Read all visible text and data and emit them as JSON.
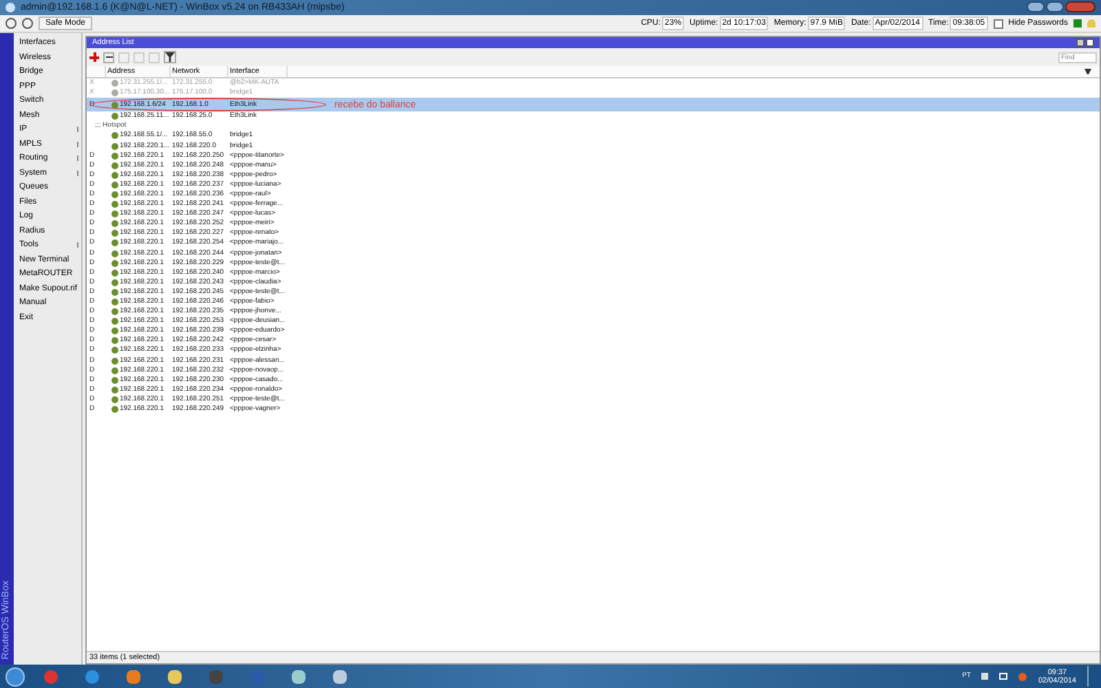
{
  "window": {
    "title": "admin@192.168.1.6 (K@N@L-NET) - WinBox v5.24 on RB433AH (mipsbe)"
  },
  "toolbar": {
    "safe_mode": "Safe Mode",
    "stats": [
      {
        "label": "CPU:",
        "value": "23%"
      },
      {
        "label": "Uptime:",
        "value": "2d 10:17:03"
      },
      {
        "label": "Memory:",
        "value": "97.9 MiB"
      },
      {
        "label": "Date:",
        "value": "Apr/02/2014"
      },
      {
        "label": "Time:",
        "value": "09:38:05"
      }
    ],
    "hide_passwords": {
      "label": "Hide Passwords",
      "checked": false
    }
  },
  "sidebar": {
    "brand": "RouterOS WinBox",
    "items": [
      {
        "label": "Interfaces",
        "submenu": false
      },
      {
        "label": "Wireless",
        "submenu": false
      },
      {
        "label": "Bridge",
        "submenu": false
      },
      {
        "label": "PPP",
        "submenu": false
      },
      {
        "label": "Switch",
        "submenu": false
      },
      {
        "label": "Mesh",
        "submenu": false
      },
      {
        "label": "IP",
        "submenu": true
      },
      {
        "label": "MPLS",
        "submenu": true
      },
      {
        "label": "Routing",
        "submenu": true
      },
      {
        "label": "System",
        "submenu": true
      },
      {
        "label": "Queues",
        "submenu": false
      },
      {
        "label": "Files",
        "submenu": false
      },
      {
        "label": "Log",
        "submenu": false
      },
      {
        "label": "Radius",
        "submenu": false
      },
      {
        "label": "Tools",
        "submenu": true
      },
      {
        "label": "New Terminal",
        "submenu": false
      },
      {
        "label": "MetaROUTER",
        "submenu": false
      },
      {
        "label": "Make Supout.rif",
        "submenu": false
      },
      {
        "label": "Manual",
        "submenu": false
      },
      {
        "label": "Exit",
        "submenu": false
      }
    ]
  },
  "address_list": {
    "title": "Address List",
    "find_placeholder": "Find",
    "columns": [
      "Address",
      "Network",
      "Interface"
    ],
    "rows": [
      {
        "kind": "entry",
        "flag": "X",
        "address": "172.31.255.1/...",
        "network": "172.31.255.0",
        "interface": "@b2>MK-AUTA",
        "disabled": true,
        "selected": false
      },
      {
        "kind": "entry",
        "flag": "X",
        "address": "175.17.100.30...",
        "network": "175.17.100.0",
        "interface": "bridge1",
        "disabled": true,
        "selected": false
      },
      {
        "kind": "entry",
        "flag": "D",
        "address": "192.168.1.6/24",
        "network": "192.168.1.0",
        "interface": "Eth3Link",
        "disabled": false,
        "selected": true
      },
      {
        "kind": "entry",
        "address": "192.168.25.11...",
        "network": "192.168.25.0",
        "interface": "Eth3Link",
        "disabled": false,
        "selected": false
      },
      {
        "kind": "comment",
        "text": ";;; Hotspot"
      },
      {
        "kind": "entry",
        "address": "192.168.55.1/...",
        "network": "192.168.55.0",
        "interface": "bridge1",
        "disabled": false,
        "selected": false
      },
      {
        "kind": "entry",
        "address": "192.168.220.1...",
        "network": "192.168.220.0",
        "interface": "bridge1",
        "disabled": false,
        "selected": false
      },
      {
        "kind": "entry",
        "flag": "D",
        "address": "192.168.220.1",
        "network": "192.168.220.250",
        "interface": "<pppoe-titanorte>",
        "disabled": false,
        "selected": false
      },
      {
        "kind": "entry",
        "flag": "D",
        "address": "192.168.220.1",
        "network": "192.168.220.248",
        "interface": "<pppoe-manu>",
        "disabled": false,
        "selected": false
      },
      {
        "kind": "entry",
        "flag": "D",
        "address": "192.168.220.1",
        "network": "192.168.220.238",
        "interface": "<pppoe-pedro>",
        "disabled": false,
        "selected": false
      },
      {
        "kind": "entry",
        "flag": "D",
        "address": "192.168.220.1",
        "network": "192.168.220.237",
        "interface": "<pppoe-luciana>",
        "disabled": false,
        "selected": false
      },
      {
        "kind": "entry",
        "flag": "D",
        "address": "192.168.220.1",
        "network": "192.168.220.236",
        "interface": "<pppoe-raul>",
        "disabled": false,
        "selected": false
      },
      {
        "kind": "entry",
        "flag": "D",
        "address": "192.168.220.1",
        "network": "192.168.220.241",
        "interface": "<pppoe-ferrage...",
        "disabled": false,
        "selected": false
      },
      {
        "kind": "entry",
        "flag": "D",
        "address": "192.168.220.1",
        "network": "192.168.220.247",
        "interface": "<pppoe-lucas>",
        "disabled": false,
        "selected": false
      },
      {
        "kind": "entry",
        "flag": "D",
        "address": "192.168.220.1",
        "network": "192.168.220.252",
        "interface": "<pppoe-meiri>",
        "disabled": false,
        "selected": false
      },
      {
        "kind": "entry",
        "flag": "D",
        "address": "192.168.220.1",
        "network": "192.168.220.227",
        "interface": "<pppoe-renato>",
        "disabled": false,
        "selected": false
      },
      {
        "kind": "entry",
        "flag": "D",
        "address": "192.168.220.1",
        "network": "192.168.220.254",
        "interface": "<pppoe-mariajo...",
        "disabled": false,
        "selected": false
      },
      {
        "kind": "entry",
        "flag": "D",
        "address": "192.168.220.1",
        "network": "192.168.220.244",
        "interface": "<pppoe-jonatan>",
        "disabled": false,
        "selected": false
      },
      {
        "kind": "entry",
        "flag": "D",
        "address": "192.168.220.1",
        "network": "192.168.220.229",
        "interface": "<pppoe-teste@t...",
        "disabled": false,
        "selected": false
      },
      {
        "kind": "entry",
        "flag": "D",
        "address": "192.168.220.1",
        "network": "192.168.220.240",
        "interface": "<pppoe-marcio>",
        "disabled": false,
        "selected": false
      },
      {
        "kind": "entry",
        "flag": "D",
        "address": "192.168.220.1",
        "network": "192.168.220.243",
        "interface": "<pppoe-claudia>",
        "disabled": false,
        "selected": false
      },
      {
        "kind": "entry",
        "flag": "D",
        "address": "192.168.220.1",
        "network": "192.168.220.245",
        "interface": "<pppoe-teste@t...",
        "disabled": false,
        "selected": false
      },
      {
        "kind": "entry",
        "flag": "D",
        "address": "192.168.220.1",
        "network": "192.168.220.246",
        "interface": "<pppoe-fabio>",
        "disabled": false,
        "selected": false
      },
      {
        "kind": "entry",
        "flag": "D",
        "address": "192.168.220.1",
        "network": "192.168.220.235",
        "interface": "<pppoe-jhonve...",
        "disabled": false,
        "selected": false
      },
      {
        "kind": "entry",
        "flag": "D",
        "address": "192.168.220.1",
        "network": "192.168.220.253",
        "interface": "<pppoe-deusian...",
        "disabled": false,
        "selected": false
      },
      {
        "kind": "entry",
        "flag": "D",
        "address": "192.168.220.1",
        "network": "192.168.220.239",
        "interface": "<pppoe-eduardo>",
        "disabled": false,
        "selected": false
      },
      {
        "kind": "entry",
        "flag": "D",
        "address": "192.168.220.1",
        "network": "192.168.220.242",
        "interface": "<pppoe-cesar>",
        "disabled": false,
        "selected": false
      },
      {
        "kind": "entry",
        "flag": "D",
        "address": "192.168.220.1",
        "network": "192.168.220.233",
        "interface": "<pppoe-elzinha>",
        "disabled": false,
        "selected": false
      },
      {
        "kind": "entry",
        "flag": "D",
        "address": "192.168.220.1",
        "network": "192.168.220.231",
        "interface": "<pppoe-alessan...",
        "disabled": false,
        "selected": false
      },
      {
        "kind": "entry",
        "flag": "D",
        "address": "192.168.220.1",
        "network": "192.168.220.232",
        "interface": "<pppoe-novaop...",
        "disabled": false,
        "selected": false
      },
      {
        "kind": "entry",
        "flag": "D",
        "address": "192.168.220.1",
        "network": "192.168.220.230",
        "interface": "<pppoe-casado...",
        "disabled": false,
        "selected": false
      },
      {
        "kind": "entry",
        "flag": "D",
        "address": "192.168.220.1",
        "network": "192.168.220.234",
        "interface": "<pppoe-ronaldo>",
        "disabled": false,
        "selected": false
      },
      {
        "kind": "entry",
        "flag": "D",
        "address": "192.168.220.1",
        "network": "192.168.220.251",
        "interface": "<pppoe-teste@t...",
        "disabled": false,
        "selected": false
      },
      {
        "kind": "entry",
        "flag": "D",
        "address": "192.168.220.1",
        "network": "192.168.220.249",
        "interface": "<pppoe-vagner>",
        "disabled": false,
        "selected": false
      }
    ],
    "annotation": "recebe do ballance",
    "status": "33 items (1 selected)"
  },
  "taskbar": {
    "language": "PT",
    "time": "09:37",
    "date": "02/04/2014"
  }
}
